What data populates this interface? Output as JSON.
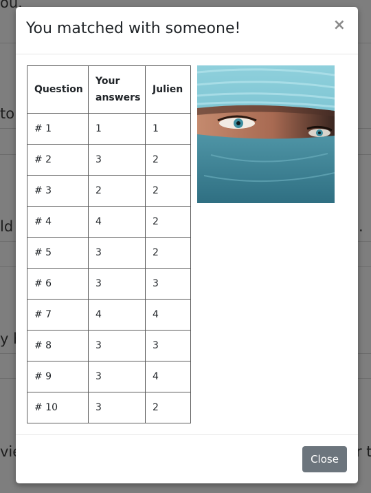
{
  "modal": {
    "title": "You matched with someone!",
    "close_icon": "×",
    "table": {
      "headers": [
        "Question",
        "Your answers",
        "Julien"
      ],
      "rows": [
        [
          "# 1",
          "1",
          "1"
        ],
        [
          "# 2",
          "3",
          "2"
        ],
        [
          "# 3",
          "2",
          "2"
        ],
        [
          "# 4",
          "4",
          "2"
        ],
        [
          "# 5",
          "3",
          "2"
        ],
        [
          "# 6",
          "3",
          "3"
        ],
        [
          "# 7",
          "4",
          "4"
        ],
        [
          "# 8",
          "3",
          "3"
        ],
        [
          "# 9",
          "3",
          "4"
        ],
        [
          "# 10",
          "3",
          "2"
        ]
      ]
    },
    "photo_icon": "profile-photo",
    "footer": {
      "close_label": "Close"
    }
  },
  "background": {
    "fragments": [
      "ou.",
      "to",
      "ld",
      ".",
      "y b",
      "vie",
      "r t"
    ]
  },
  "colors": {
    "overlay": "#7e7e7e",
    "button": "#6c757d",
    "scarf": "#6fb7c6"
  }
}
